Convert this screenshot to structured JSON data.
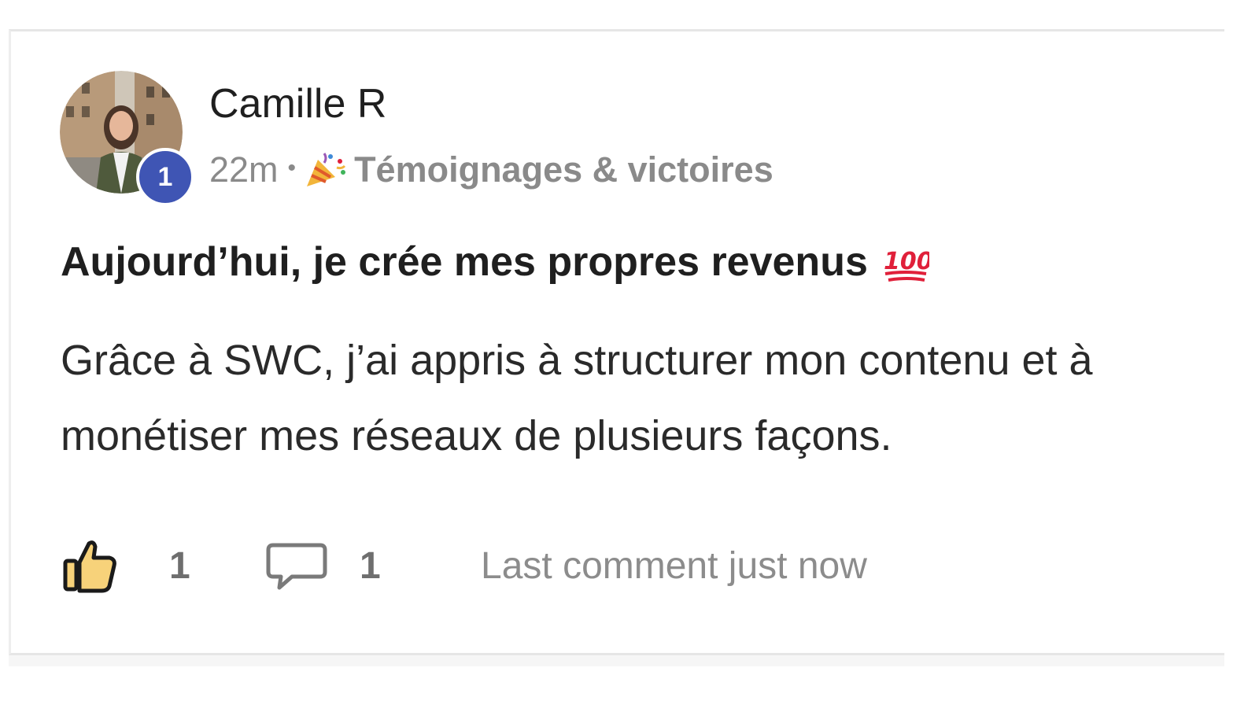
{
  "post": {
    "author": {
      "name": "Camille R",
      "level": "1",
      "avatar": "profile-photo"
    },
    "meta": {
      "time": "22m",
      "separator": "•",
      "category_icon": "party-popper-icon",
      "category": "Témoignages & victoires"
    },
    "title": "Aujourd’hui, je crée mes propres revenus",
    "title_icon": "hundred-points-icon",
    "body": "Grâce à SWC, j’ai appris à structurer mon contenu et à monétiser mes réseaux de plusieurs façons.",
    "actions": {
      "like_icon": "thumbs-up-icon",
      "like_count": "1",
      "comment_icon": "comment-bubble-icon",
      "comment_count": "1",
      "last_comment": "Last comment just now"
    }
  },
  "colors": {
    "badge": "#3f55b4",
    "text_primary": "#1f1f1f",
    "text_muted": "#8a8a8a",
    "thumb_fill": "#f7d27a",
    "hundred_red": "#e0203a"
  }
}
